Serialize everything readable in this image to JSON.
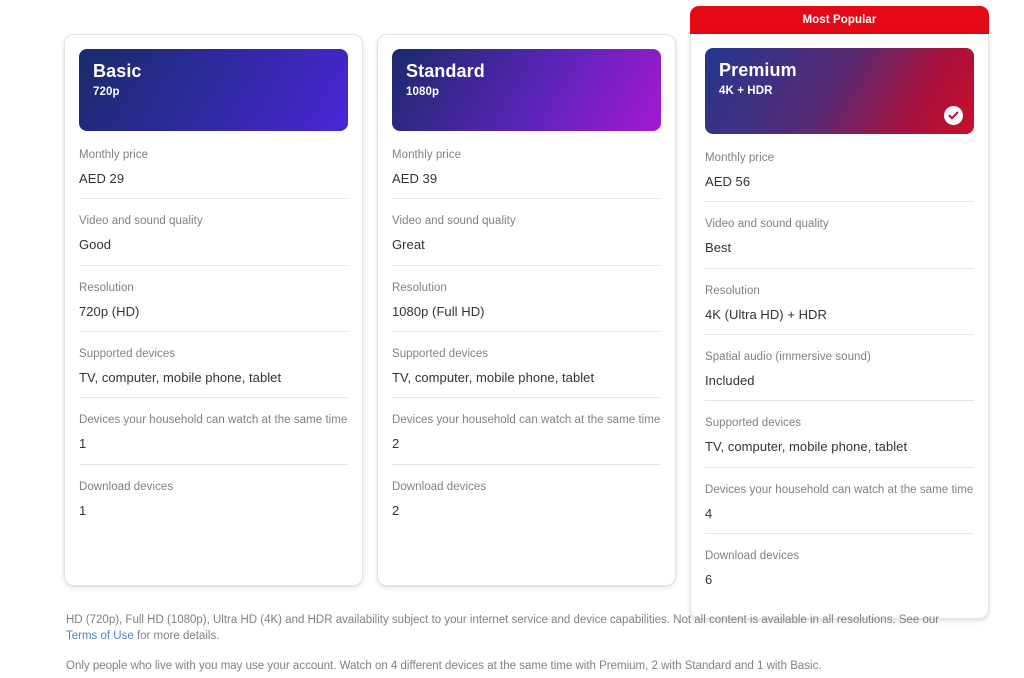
{
  "featured_banner_label": "Most Popular",
  "colors": {
    "banner_red": "#e40914",
    "link_blue": "#4d82d8",
    "label_gray": "#808080",
    "value_dark": "#333333"
  },
  "plans": [
    {
      "id": "basic",
      "name": "Basic",
      "quality": "720p",
      "featured": false,
      "selected": false,
      "features": [
        {
          "label": "Monthly price",
          "value": "AED 29"
        },
        {
          "label": "Video and sound quality",
          "value": "Good"
        },
        {
          "label": "Resolution",
          "value": "720p (HD)"
        },
        {
          "label": "Supported devices",
          "value": "TV, computer, mobile phone, tablet"
        },
        {
          "label": "Devices your household can watch at the same time",
          "value": "1"
        },
        {
          "label": "Download devices",
          "value": "1"
        }
      ]
    },
    {
      "id": "standard",
      "name": "Standard",
      "quality": "1080p",
      "featured": false,
      "selected": false,
      "features": [
        {
          "label": "Monthly price",
          "value": "AED 39"
        },
        {
          "label": "Video and sound quality",
          "value": "Great"
        },
        {
          "label": "Resolution",
          "value": "1080p (Full HD)"
        },
        {
          "label": "Supported devices",
          "value": "TV, computer, mobile phone, tablet"
        },
        {
          "label": "Devices your household can watch at the same time",
          "value": "2"
        },
        {
          "label": "Download devices",
          "value": "2"
        }
      ]
    },
    {
      "id": "premium",
      "name": "Premium",
      "quality": "4K + HDR",
      "featured": true,
      "selected": true,
      "selected_icon": "check-circle-icon",
      "features": [
        {
          "label": "Monthly price",
          "value": "AED 56"
        },
        {
          "label": "Video and sound quality",
          "value": "Best"
        },
        {
          "label": "Resolution",
          "value": "4K (Ultra HD) + HDR"
        },
        {
          "label": "Spatial audio (immersive sound)",
          "value": "Included"
        },
        {
          "label": "Supported devices",
          "value": "TV, computer, mobile phone, tablet"
        },
        {
          "label": "Devices your household can watch at the same time",
          "value": "4"
        },
        {
          "label": "Download devices",
          "value": "6"
        }
      ]
    }
  ],
  "footer": {
    "disclaimer_1_part_1": "HD (720p), Full HD (1080p), Ultra HD (4K) and HDR availability subject to your internet service and device capabilities. Not all content is available in all resolutions. See our ",
    "terms_link_label": "Terms of Use",
    "disclaimer_1_part_2": " for more details.",
    "disclaimer_2": "Only people who live with you may use your account. Watch on 4 different devices at the same time with Premium, 2 with Standard and 1 with Basic."
  }
}
